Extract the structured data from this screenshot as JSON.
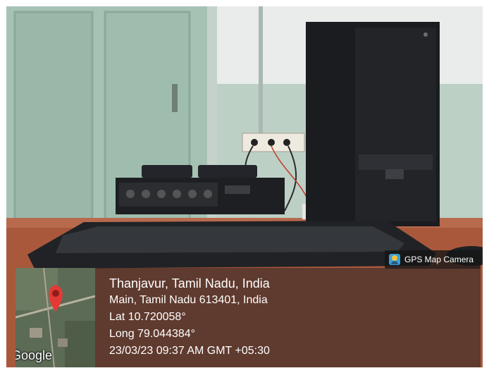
{
  "badge": {
    "label": "GPS Map Camera",
    "icon": "gps-map-camera-app-icon"
  },
  "map": {
    "provider_label": "Google",
    "pin_icon": "location-pin-icon",
    "pin_color": "#e53935"
  },
  "location": {
    "title": "Thanjavur, Tamil Nadu, India",
    "address": "Main, Tamil Nadu 613401, India",
    "lat": "Lat 10.720058°",
    "long": "Long 79.044384°",
    "datetime": "23/03/23 09:37 AM GMT +05:30"
  },
  "colors": {
    "wall": "#b9cdc3",
    "door": "#9fbcaf",
    "cabinet": "#1c1d1f",
    "keyboard": "#24262a",
    "table": "#a8573c"
  }
}
